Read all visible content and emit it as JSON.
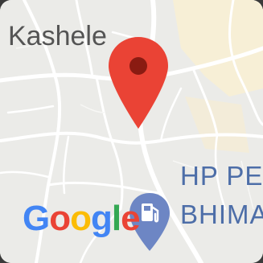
{
  "map": {
    "labels": {
      "locality": "Kashele",
      "poi_line1": "HP PE",
      "poi_line2": "BHIMA"
    },
    "attribution": {
      "logo_letters": [
        "G",
        "o",
        "o",
        "g",
        "l",
        "e"
      ],
      "logo_colors": [
        "#4285F4",
        "#EA4335",
        "#FBBC05",
        "#4285F4",
        "#34A853",
        "#EA4335"
      ]
    },
    "markers": {
      "location_pin_icon": "map-pin-icon",
      "location_pin_color": "#EA4335",
      "poi_icon": "fuel-station-pin-icon",
      "poi_color": "#4d6ea8"
    },
    "colors": {
      "land": "#ebebe8",
      "roads": "#ffffff",
      "highlight_area": "#f7efd6"
    }
  }
}
